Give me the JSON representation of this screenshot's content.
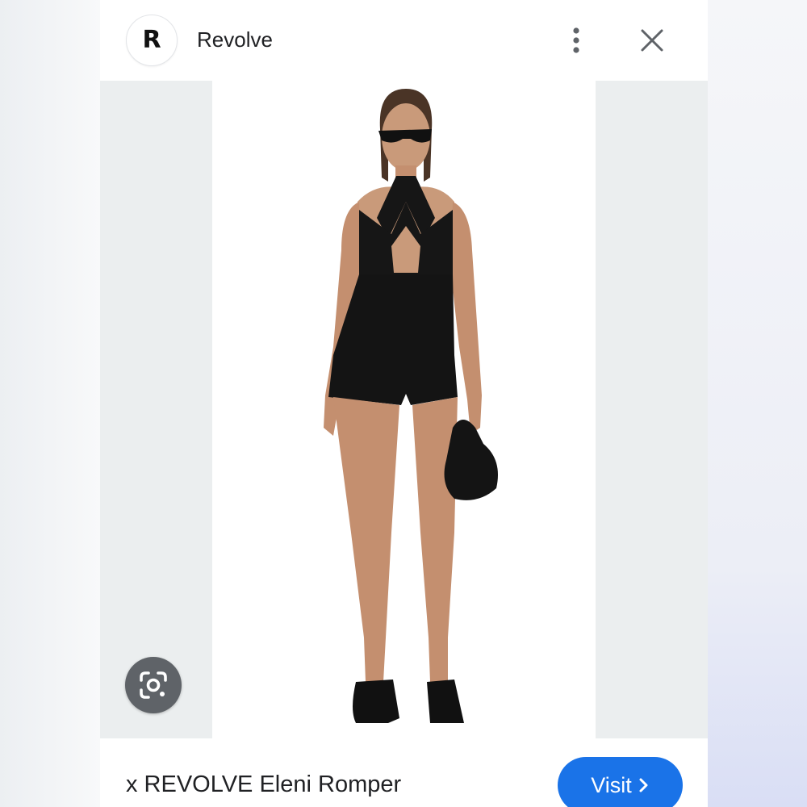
{
  "header": {
    "avatar_letter": "R",
    "site_name": "Revolve",
    "more_icon": "more-vert-icon",
    "close_icon": "close-icon"
  },
  "image": {
    "lens_icon": "google-lens-icon"
  },
  "footer": {
    "product_title": "x REVOLVE Eleni Romper",
    "visit_label": "Visit",
    "visit_icon": "chevron-right-icon"
  },
  "colors": {
    "accent": "#1a73e8",
    "lens_button": "#5f6368",
    "text": "#202124",
    "image_backdrop": "#ebeeef"
  }
}
